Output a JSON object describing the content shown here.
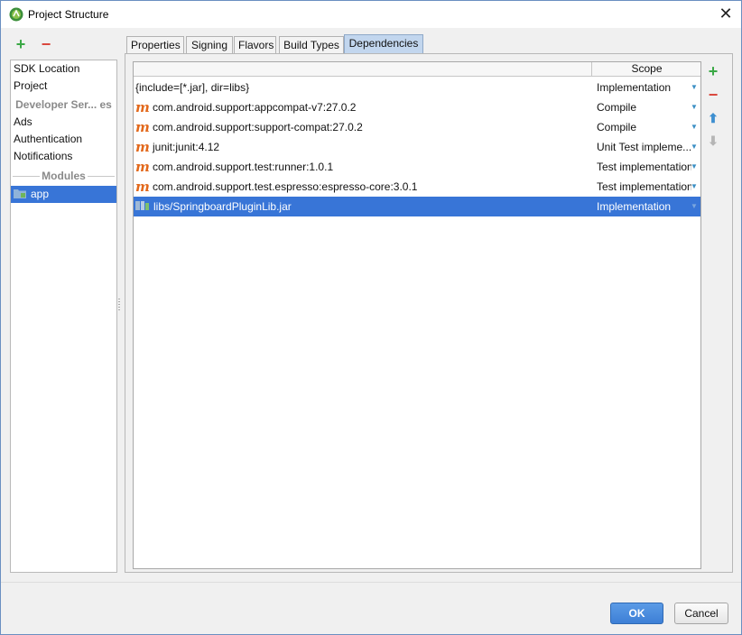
{
  "window": {
    "title": "Project Structure",
    "close_glyph": "✕"
  },
  "left_toolbar": {
    "add_glyph": "+",
    "remove_glyph": "−"
  },
  "left_items": [
    {
      "label": "SDK Location"
    },
    {
      "label": "Project"
    }
  ],
  "developer_services": {
    "group_label": "Developer Ser... es",
    "items": [
      {
        "label": "Ads"
      },
      {
        "label": "Authentication"
      },
      {
        "label": "Notifications"
      }
    ]
  },
  "modules": {
    "group_label": "Modules",
    "items": [
      {
        "label": "app",
        "selected": true
      }
    ]
  },
  "tabs": [
    {
      "label": "Properties"
    },
    {
      "label": "Signing"
    },
    {
      "label": "Flavors"
    },
    {
      "label": "Build Types"
    },
    {
      "label": "Dependencies",
      "active": true
    }
  ],
  "table": {
    "columns": {
      "name": "",
      "scope": "Scope"
    },
    "rows": [
      {
        "icon": "none",
        "name": "{include=[*.jar], dir=libs}",
        "scope": "Implementation"
      },
      {
        "icon": "maven-icon",
        "name": "com.android.support:appcompat-v7:27.0.2",
        "scope": "Compile"
      },
      {
        "icon": "maven-icon",
        "name": "com.android.support:support-compat:27.0.2",
        "scope": "Compile"
      },
      {
        "icon": "maven-icon",
        "name": "junit:junit:4.12",
        "scope": "Unit Test impleme..."
      },
      {
        "icon": "maven-icon",
        "name": "com.android.support.test:runner:1.0.1",
        "scope": "Test implementation"
      },
      {
        "icon": "maven-icon",
        "name": "com.android.support.test.espresso:espresso-core:3.0.1",
        "scope": "Test implementation"
      },
      {
        "icon": "jar-icon",
        "name": "libs/SpringboardPluginLib.jar",
        "scope": "Implementation",
        "selected": true
      }
    ],
    "maven_glyph": "m"
  },
  "side_toolbar": {
    "add_glyph": "+",
    "remove_glyph": "−",
    "up_glyph": "⬆",
    "down_glyph": "⬇"
  },
  "footer": {
    "ok_label": "OK",
    "cancel_label": "Cancel"
  },
  "colors": {
    "accent": "#3875d7",
    "add": "#3aa845",
    "remove": "#d9463c",
    "maven": "#e2681b",
    "active_tab": "#c2d6ee"
  }
}
